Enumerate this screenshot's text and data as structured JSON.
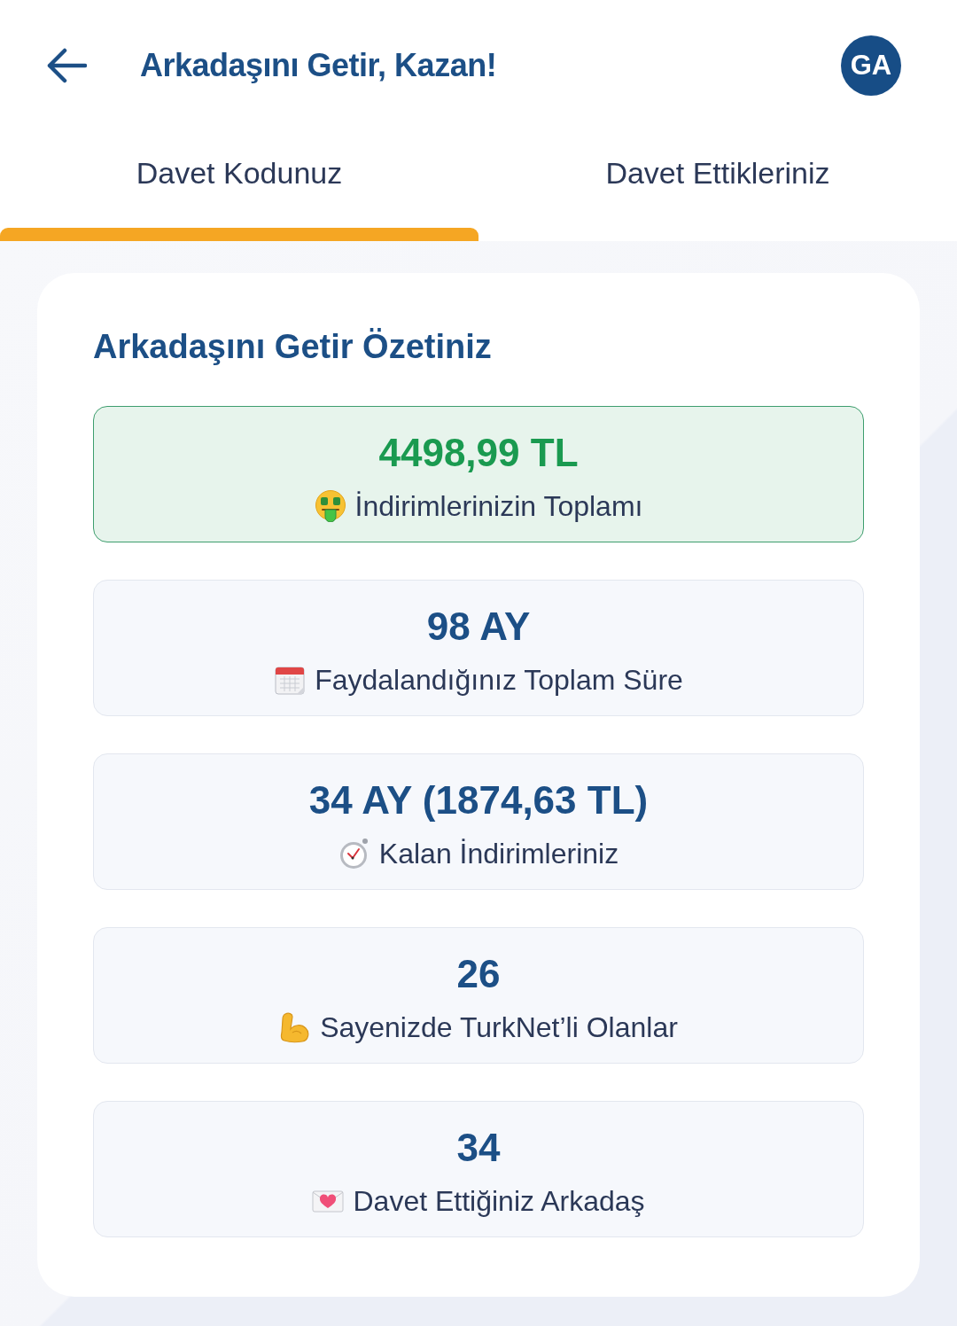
{
  "header": {
    "title": "Arkadaşını Getir, Kazan!",
    "avatar_initials": "GA"
  },
  "tabs": [
    {
      "label": "Davet Kodunuz",
      "selected": true
    },
    {
      "label": "Davet Ettikleriniz",
      "selected": false
    }
  ],
  "summary": {
    "title": "Arkadaşını Getir Özetiniz",
    "stats": [
      {
        "value": "4498,99 TL",
        "label": "İndirimlerinizin Toplamı",
        "highlighted": true
      },
      {
        "value": "98 AY",
        "label": "Faydalandığınız Toplam Süre",
        "highlighted": false
      },
      {
        "value": "34 AY (1874,63 TL)",
        "label": "Kalan İndirimleriniz",
        "highlighted": false
      },
      {
        "value": "26",
        "label": "Sayenizde TurkNet’li Olanlar",
        "highlighted": false
      },
      {
        "value": "34",
        "label": "Davet Ettiğiniz Arkadaş",
        "highlighted": false
      }
    ]
  }
}
